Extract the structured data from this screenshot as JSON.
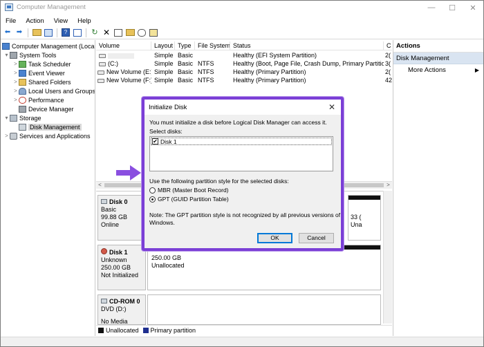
{
  "window": {
    "title": "Computer Management",
    "controls": {
      "minimize": "—",
      "maximize": "☐",
      "close": "✕"
    }
  },
  "menu": [
    "File",
    "Action",
    "View",
    "Help"
  ],
  "tree": [
    {
      "label": "Computer Management (Local",
      "icon": "computer-icon",
      "level": 0,
      "arrow": ""
    },
    {
      "label": "System Tools",
      "icon": "tools-icon",
      "level": 1,
      "arrow": "▾"
    },
    {
      "label": "Task Scheduler",
      "icon": "task-scheduler-icon",
      "level": 2,
      "arrow": ">"
    },
    {
      "label": "Event Viewer",
      "icon": "event-viewer-icon",
      "level": 2,
      "arrow": ">"
    },
    {
      "label": "Shared Folders",
      "icon": "shared-folders-icon",
      "level": 2,
      "arrow": ">"
    },
    {
      "label": "Local Users and Groups",
      "icon": "users-icon",
      "level": 2,
      "arrow": ">"
    },
    {
      "label": "Performance",
      "icon": "performance-icon",
      "level": 2,
      "arrow": ">"
    },
    {
      "label": "Device Manager",
      "icon": "device-manager-icon",
      "level": 2,
      "arrow": ""
    },
    {
      "label": "Storage",
      "icon": "storage-icon",
      "level": 1,
      "arrow": "▾"
    },
    {
      "label": "Disk Management",
      "icon": "disk-management-icon",
      "level": 2,
      "arrow": ""
    },
    {
      "label": "Services and Applications",
      "icon": "services-icon",
      "level": 1,
      "arrow": ">"
    }
  ],
  "volumes": {
    "columns": [
      "Volume",
      "Layout",
      "Type",
      "File System",
      "Status",
      "C"
    ],
    "rows": [
      {
        "volume": "",
        "layout": "Simple",
        "type": "Basic",
        "fs": "",
        "status": "Healthy (EFI System Partition)",
        "c": "2("
      },
      {
        "volume": "(C:)",
        "layout": "Simple",
        "type": "Basic",
        "fs": "NTFS",
        "status": "Healthy (Boot, Page File, Crash Dump, Primary Partition)",
        "c": "3("
      },
      {
        "volume": "New Volume (E:)",
        "layout": "Simple",
        "type": "Basic",
        "fs": "NTFS",
        "status": "Healthy (Primary Partition)",
        "c": "2("
      },
      {
        "volume": "New Volume (F:)",
        "layout": "Simple",
        "type": "Basic",
        "fs": "NTFS",
        "status": "Healthy (Primary Partition)",
        "c": "42"
      }
    ]
  },
  "disks": [
    {
      "name": "Disk 0",
      "lines": [
        "Basic",
        "99.88 GB",
        "Online"
      ],
      "partition_lines": [
        "33 (",
        "Una"
      ]
    },
    {
      "name": "Disk 1",
      "lines": [
        "Unknown",
        "250.00 GB",
        "Not Initialized"
      ],
      "partition_lines": [
        "250.00 GB",
        "Unallocated"
      ]
    },
    {
      "name": "CD-ROM 0",
      "lines": [
        "DVD (D:)",
        "",
        "No Media"
      ]
    }
  ],
  "legend": [
    {
      "label": "Unallocated",
      "color": "#111111"
    },
    {
      "label": "Primary partition",
      "color": "#1f2f8f"
    }
  ],
  "actions": {
    "title": "Actions",
    "section": "Disk Management",
    "more": "More Actions"
  },
  "dialog": {
    "title": "Initialize Disk",
    "intro": "You must initialize a disk before Logical Disk Manager can access it.",
    "select_label": "Select disks:",
    "disk_item": "Disk 1",
    "disk_checked": true,
    "style_label": "Use the following partition style for the selected disks:",
    "options": [
      "MBR (Master Boot Record)",
      "GPT (GUID Partition Table)"
    ],
    "selected_option": 1,
    "note_line1": "Note: The GPT partition style is not recognized by all previous versions of",
    "note_line2": "Windows.",
    "ok": "OK",
    "cancel": "Cancel"
  },
  "colors": {
    "highlight_border": "#7b3fd6",
    "arrow": "#8a4fe0",
    "selection": "#d9e4f1",
    "partition_blue": "#1f2f8f",
    "unallocated_black": "#111111"
  }
}
